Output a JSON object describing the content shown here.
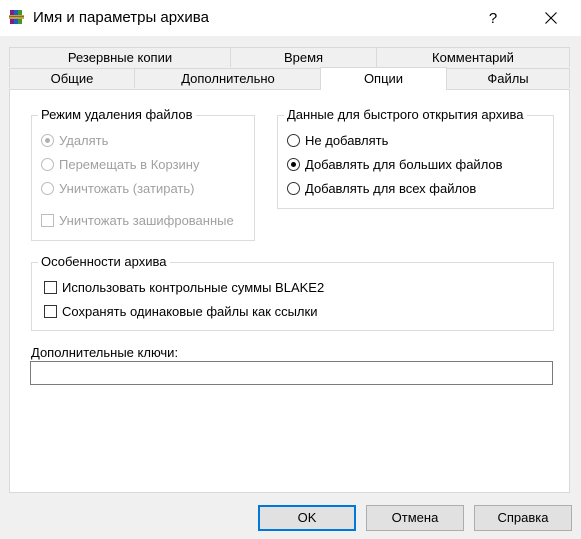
{
  "window": {
    "title": "Имя и параметры архива",
    "help_glyph": "?",
    "icon": "winrar-books-icon"
  },
  "tabs": {
    "row1": [
      {
        "label": "Резервные копии"
      },
      {
        "label": "Время"
      },
      {
        "label": "Комментарий"
      }
    ],
    "row2": [
      {
        "label": "Общие"
      },
      {
        "label": "Дополнительно"
      },
      {
        "label": "Опции",
        "active": true
      },
      {
        "label": "Файлы"
      }
    ]
  },
  "delete_mode": {
    "title": "Режим удаления файлов",
    "enabled": false,
    "options": [
      {
        "label": "Удалять",
        "selected": true
      },
      {
        "label": "Перемещать в Корзину",
        "selected": false
      },
      {
        "label": "Уничтожать (затирать)",
        "selected": false
      }
    ],
    "checkbox": {
      "label": "Уничтожать зашифрованные",
      "checked": false
    }
  },
  "quick_open": {
    "title": "Данные для быстрого открытия архива",
    "options": [
      {
        "label": "Не добавлять",
        "selected": false
      },
      {
        "label": "Добавлять для больших файлов",
        "selected": true
      },
      {
        "label": "Добавлять для всех файлов",
        "selected": false
      }
    ]
  },
  "features": {
    "title": "Особенности архива",
    "checkboxes": [
      {
        "label": "Использовать контрольные суммы BLAKE2",
        "checked": false
      },
      {
        "label": "Сохранять одинаковые файлы как ссылки",
        "checked": false
      }
    ]
  },
  "extra_switches": {
    "label": "Дополнительные ключи:",
    "value": ""
  },
  "buttons": {
    "ok": "OK",
    "cancel": "Отмена",
    "help": "Справка"
  },
  "colors": {
    "default_button_border": "#0078d7",
    "disabled_text": "#a0a0a0"
  }
}
